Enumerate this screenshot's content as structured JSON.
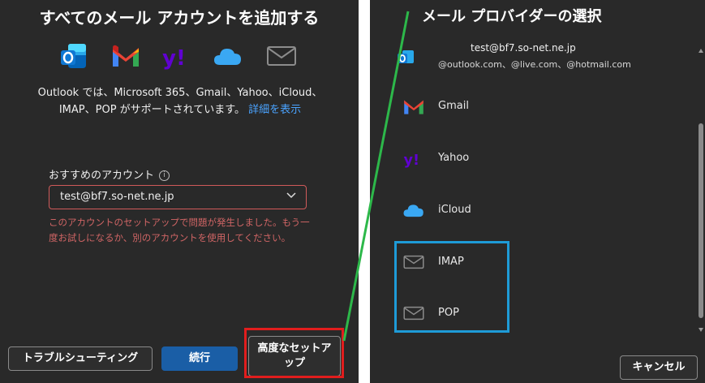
{
  "left": {
    "title": "すべてのメール アカウントを追加する",
    "description_prefix": "Outlook では、Microsoft 365、Gmail、Yahoo、iCloud、IMAP、POP がサポートされています。",
    "description_link": "詳細を表示",
    "recommended_label": "おすすめのアカウント",
    "account_value": "test@bf7.so-net.ne.jp",
    "error_message": "このアカウントのセットアップで問題が発生しました。もう一度お試しになるか、別のアカウントを使用してください。",
    "buttons": {
      "troubleshoot": "トラブルシューティング",
      "continue": "続行",
      "advanced_line1": "高度なセットア",
      "advanced_line2": "ップ"
    },
    "logos": [
      "outlook-icon",
      "gmail-icon",
      "yahoo-icon",
      "icloud-icon",
      "mail-icon"
    ]
  },
  "right": {
    "title": "メール プロバイダーの選択",
    "top_account": "test@bf7.so-net.ne.jp",
    "top_account_domains": "@outlook.com、@live.com、@hotmail.com",
    "providers": [
      "Gmail",
      "Yahoo",
      "iCloud",
      "IMAP",
      "POP"
    ],
    "cancel": "キャンセル"
  },
  "colors": {
    "panel_bg": "#292929",
    "accent_blue": "#1a5ea6",
    "link": "#4aa3ff",
    "error": "#d06565",
    "highlight_red": "#e11d1d",
    "highlight_blue": "#1e9bd7",
    "connector_green": "#2db84a"
  }
}
